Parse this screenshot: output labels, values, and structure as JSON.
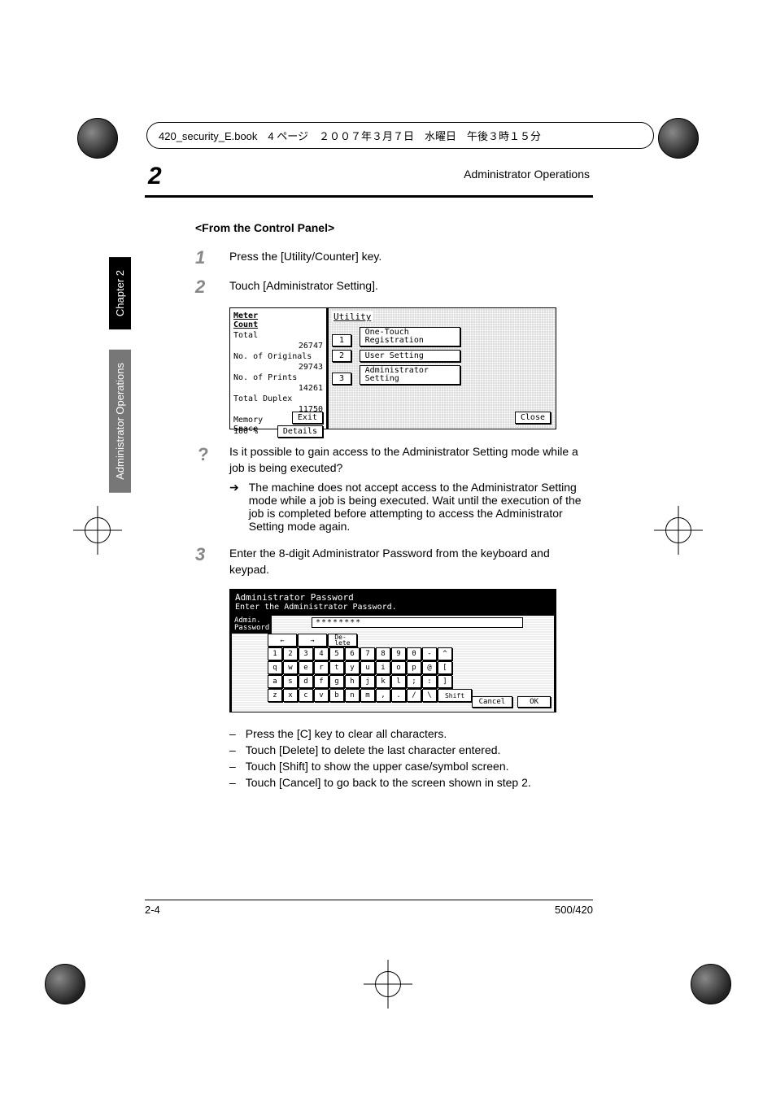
{
  "header_line": "420_security_E.book　4 ページ　２００７年３月７日　水曜日　午後３時１５分",
  "chapter_number_display": "2",
  "page_header_title": "Administrator Operations",
  "side_tab_chapter": "Chapter 2",
  "side_tab_section": "Administrator Operations",
  "section_title": "<From the Control Panel>",
  "steps": {
    "s1": {
      "num": "1",
      "text": "Press the [Utility/Counter] key."
    },
    "s2": {
      "num": "2",
      "text": "Touch [Administrator Setting]."
    },
    "s3": {
      "num": "3",
      "text": "Enter the 8-digit Administrator Password from the keyboard and keypad."
    }
  },
  "qa": {
    "question": "Is it possible to gain access to the Administrator Setting mode while a job is being executed?",
    "answer": "The machine does not accept access to the Administrator Setting mode while a job is being executed. Wait until the execution of the job is completed before attempting to access the Administrator Setting mode again."
  },
  "bullets": {
    "b1": "Press the [C] key to clear all characters.",
    "b2": "Touch [Delete] to delete the last character entered.",
    "b3": "Touch [Shift] to show the upper case/symbol screen.",
    "b4": "Touch [Cancel] to go back to the screen shown in step 2."
  },
  "device1": {
    "meter_count": "Meter\nCount",
    "total_label": "Total",
    "total_val": "26747",
    "orig_label": "No. of Originals",
    "orig_val": "29743",
    "prints_label": "No. of Prints",
    "prints_val": "14261",
    "duplex_label": "Total Duplex",
    "duplex_val": "11750",
    "memory_label": "Memory\nSpace",
    "memory_val": "100 %",
    "details_btn": "Details",
    "exit_btn": "Exit",
    "utility_title": "Utility",
    "opt1_num": "1",
    "opt1": "One-Touch\nRegistration",
    "opt2_num": "2",
    "opt2": "User Setting",
    "opt3_num": "3",
    "opt3": "Administrator\nSetting",
    "close_btn": "Close"
  },
  "device2": {
    "title1": "Administrator Password",
    "title2": "Enter the Administrator Password.",
    "label": "Admin.\nPassword",
    "pwd_mask": "********",
    "arrow_left": "←",
    "arrow_right": "→",
    "delete_btn": "De-\nlete",
    "row_num": [
      "1",
      "2",
      "3",
      "4",
      "5",
      "6",
      "7",
      "8",
      "9",
      "0",
      "-",
      "^"
    ],
    "row_q": [
      "q",
      "w",
      "e",
      "r",
      "t",
      "y",
      "u",
      "i",
      "o",
      "p",
      "@",
      "["
    ],
    "row_a": [
      "a",
      "s",
      "d",
      "f",
      "g",
      "h",
      "j",
      "k",
      "l",
      ";",
      ":",
      "]"
    ],
    "row_z": [
      "z",
      "x",
      "c",
      "v",
      "b",
      "n",
      "m",
      ",",
      ".",
      "/",
      "\\"
    ],
    "shift_btn": "Shift",
    "cancel_btn": "Cancel",
    "ok_btn": "OK"
  },
  "footer": {
    "left": "2-4",
    "right": "500/420"
  }
}
